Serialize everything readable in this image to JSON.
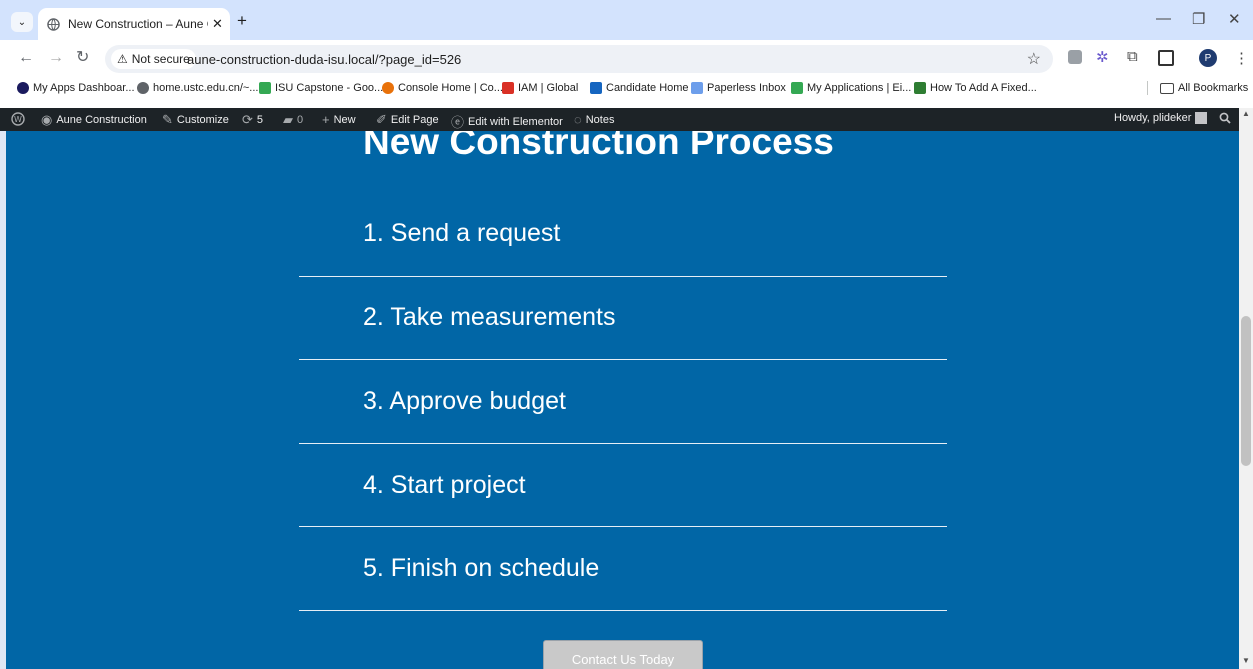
{
  "browser": {
    "tab": {
      "title": "New Construction – Aune Cons",
      "close": "✕"
    },
    "new_tab": "+",
    "window": {
      "minimize": "—",
      "restore": "❐",
      "close": "✕"
    },
    "omnibox": {
      "security_label": "Not secure",
      "url": "aune-construction-duda-isu.local/?page_id=526"
    },
    "profile_initial": "P",
    "bookmarks": [
      "My Apps Dashboar...",
      "home.ustc.edu.cn/~...",
      "ISU Capstone - Goo...",
      "Console Home | Co...",
      "IAM | Global",
      "Candidate Home",
      "Paperless Inbox",
      "My Applications | Ei...",
      "How To Add A Fixed..."
    ],
    "all_bookmarks": "All Bookmarks"
  },
  "adminbar": {
    "site_name": "Aune Construction",
    "customize": "Customize",
    "updates_count": "5",
    "comments_count": "0",
    "new": "New",
    "edit_page": "Edit Page",
    "edit_with_elementor": "Edit with Elementor",
    "notes": "Notes",
    "howdy": "Howdy, plideker"
  },
  "page": {
    "heading": "New Construction Process",
    "steps": [
      "1. Send a request",
      "2. Take measurements",
      "3. Approve budget",
      "4. Start project",
      "5. Finish on schedule"
    ],
    "cta": "Contact Us Today"
  },
  "colors": {
    "page_background": "#0166a6",
    "adminbar": "#1d2327",
    "tabstrip": "#d3e3fd"
  }
}
